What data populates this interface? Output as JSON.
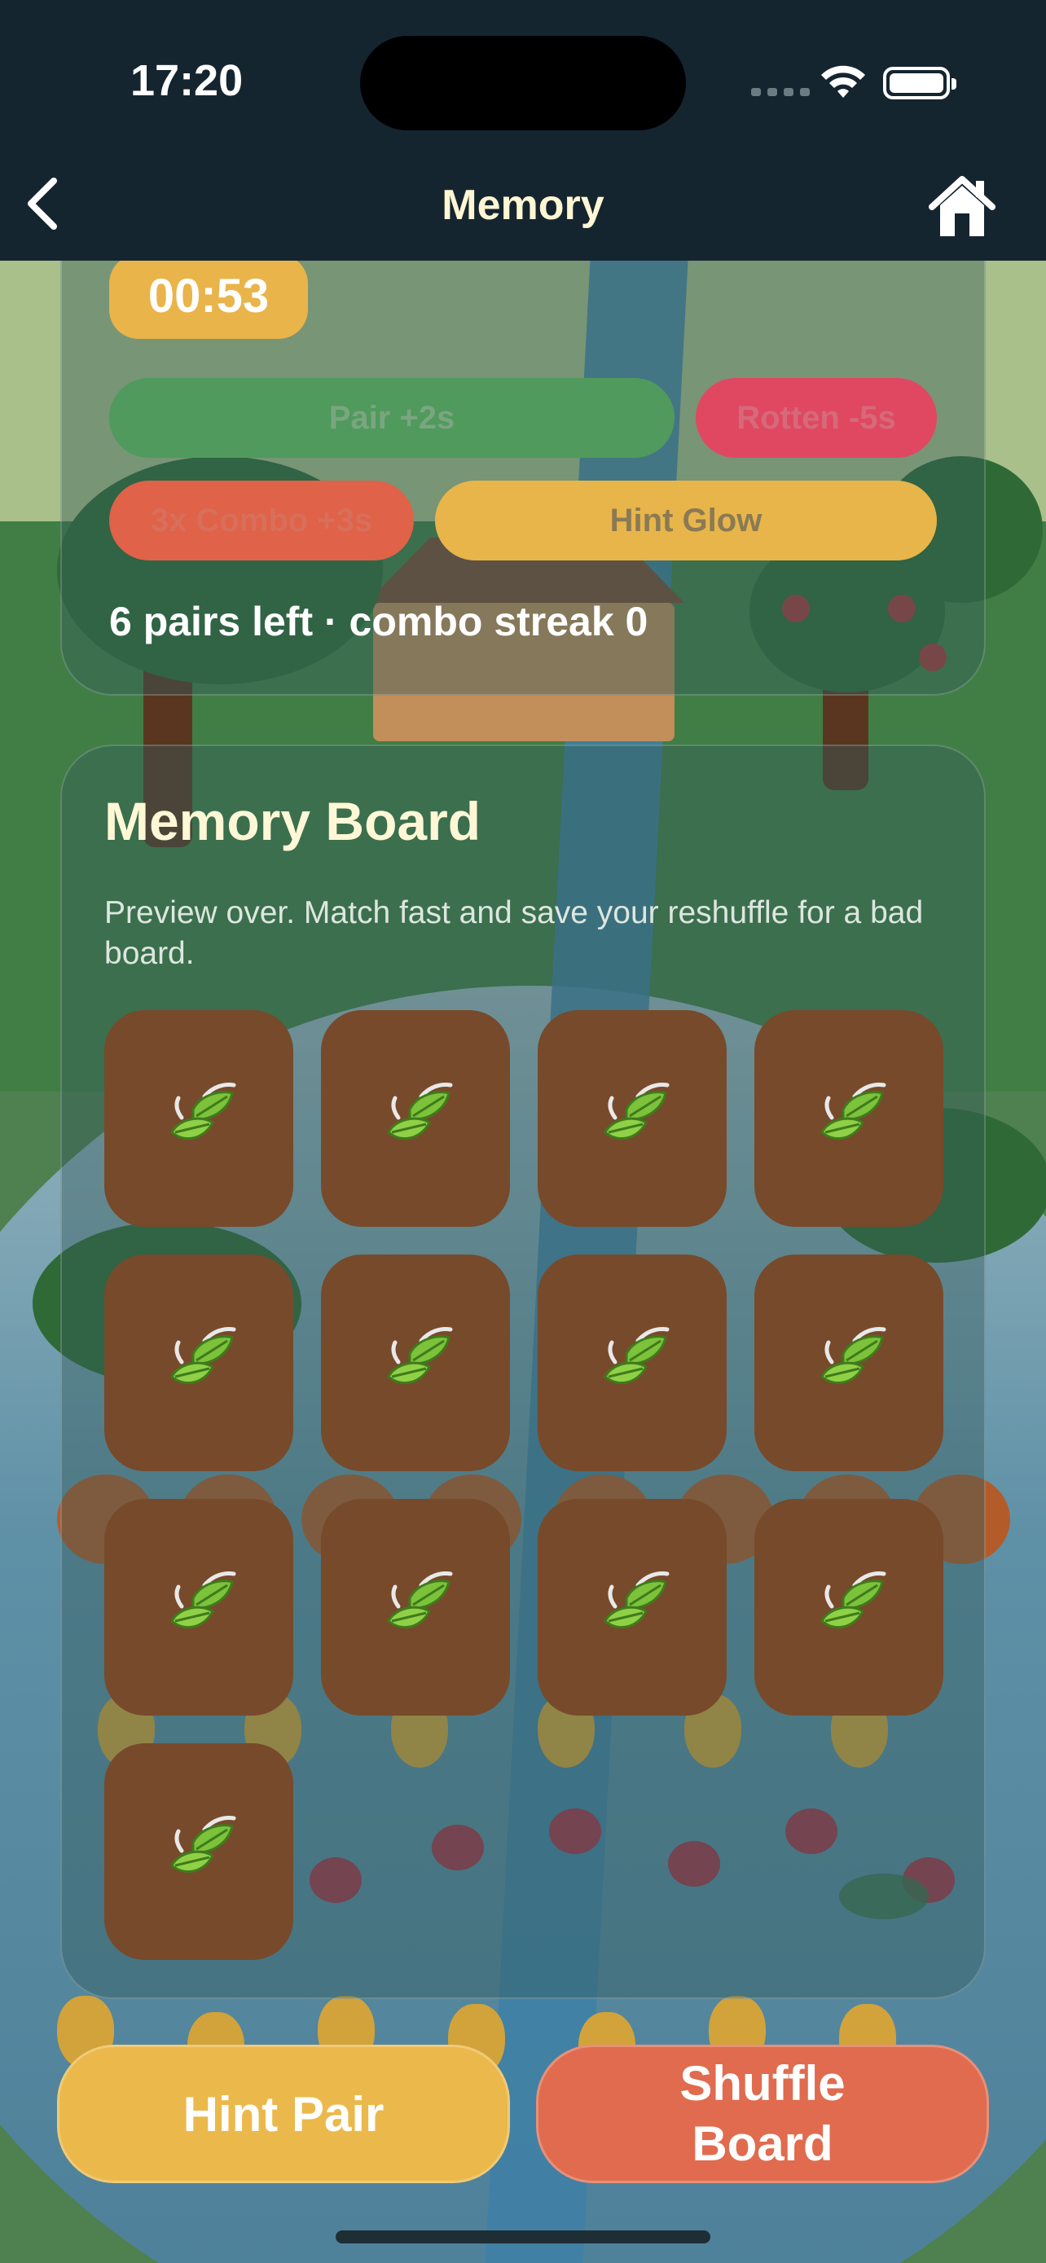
{
  "status_bar": {
    "time": "17:20",
    "icons": [
      "cellular-icon",
      "wifi-icon",
      "battery-icon"
    ]
  },
  "nav": {
    "title": "Memory",
    "back_icon": "chevron-left-icon",
    "home_icon": "home-icon"
  },
  "stats": {
    "timer": "00:53",
    "pills": {
      "pair": "Pair +2s",
      "rotten": "Rotten -5s",
      "combo": "3x Combo +3s",
      "hint": "Hint Glow"
    },
    "pairs_left": "6 pairs left · combo streak 0"
  },
  "board": {
    "title": "Memory Board",
    "subtitle": "Preview over. Match fast and save your reshuffle for a bad board.",
    "tile_icon": "leaf-card-back-icon",
    "tiles": [
      {
        "state": "face-down"
      },
      {
        "state": "face-down"
      },
      {
        "state": "face-down"
      },
      {
        "state": "face-down"
      },
      {
        "state": "face-down"
      },
      {
        "state": "face-down"
      },
      {
        "state": "face-down"
      },
      {
        "state": "face-down"
      },
      {
        "state": "face-down"
      },
      {
        "state": "face-down"
      },
      {
        "state": "face-down"
      },
      {
        "state": "face-down"
      },
      {
        "state": "face-down"
      }
    ]
  },
  "actions": {
    "hint_pair": "Hint Pair",
    "shuffle_board": "Shuffle Board"
  },
  "colors": {
    "header": "#152530",
    "timer": "#e9b44a",
    "tile": "#774a2b",
    "hint_button": "#ebb94b",
    "shuffle_button": "#e06b4e"
  }
}
